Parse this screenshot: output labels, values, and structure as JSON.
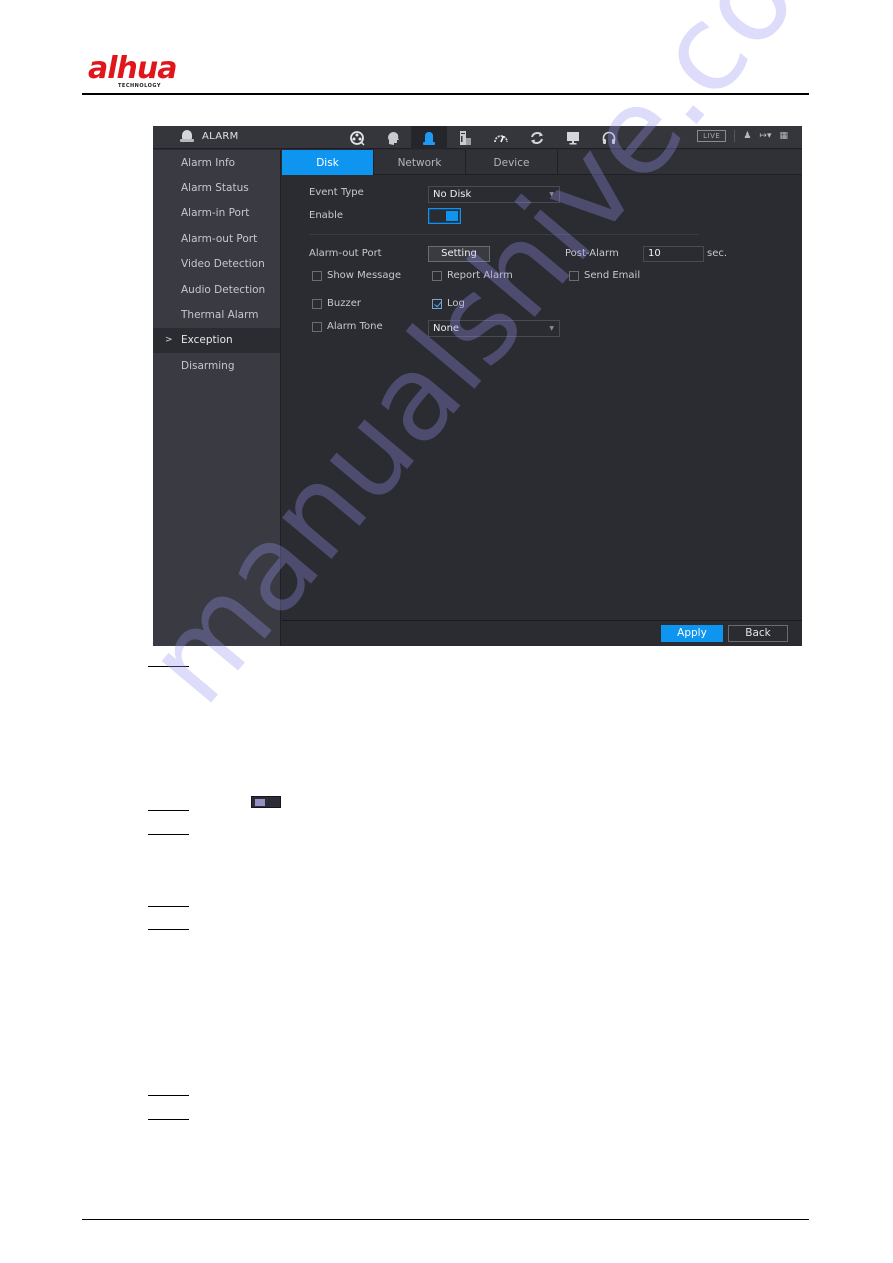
{
  "document": {
    "brand": {
      "name": "alhua",
      "tagline": "TECHNOLOGY",
      "color": "#e0161b"
    },
    "watermark": "manualshive.com"
  },
  "ui": {
    "window": {
      "title": "ALARM",
      "title_icon": "alarm-bell-icon"
    },
    "nav_icons": [
      {
        "name": "playback-icon",
        "active": false
      },
      {
        "name": "ai-face-icon",
        "active": false
      },
      {
        "name": "alarm-bell-icon",
        "active": true
      },
      {
        "name": "storage-icon",
        "active": false
      },
      {
        "name": "performance-gauge-icon",
        "active": false
      },
      {
        "name": "sync-icon",
        "active": false
      },
      {
        "name": "display-monitor-icon",
        "active": false
      },
      {
        "name": "audio-headset-icon",
        "active": false
      }
    ],
    "toolbar": {
      "live_label": "LIVE",
      "user_icon": "user-icon",
      "logout_icon": "logout-icon",
      "grid_icon": "grid-icon"
    },
    "sidebar": {
      "items": [
        {
          "label": "Alarm Info",
          "active": false
        },
        {
          "label": "Alarm Status",
          "active": false
        },
        {
          "label": "Alarm-in Port",
          "active": false
        },
        {
          "label": "Alarm-out Port",
          "active": false
        },
        {
          "label": "Video Detection",
          "active": false
        },
        {
          "label": "Audio Detection",
          "active": false
        },
        {
          "label": "Thermal Alarm",
          "active": false
        },
        {
          "label": "Exception",
          "active": true
        },
        {
          "label": "Disarming",
          "active": false
        }
      ],
      "active_marker": ">"
    },
    "tabs": [
      {
        "label": "Disk",
        "active": true
      },
      {
        "label": "Network",
        "active": false
      },
      {
        "label": "Device",
        "active": false
      }
    ],
    "form": {
      "event_type_label": "Event Type",
      "event_type_value": "No Disk",
      "enable_label": "Enable",
      "enable_on": true,
      "alarm_out_port_label": "Alarm-out Port",
      "setting_button": "Setting",
      "post_alarm_label": "Post-Alarm",
      "post_alarm_value": "10",
      "post_alarm_unit": "sec.",
      "checkboxes": {
        "show_message": {
          "label": "Show Message",
          "checked": false
        },
        "report_alarm": {
          "label": "Report Alarm",
          "checked": false
        },
        "send_email": {
          "label": "Send Email",
          "checked": false
        },
        "buzzer": {
          "label": "Buzzer",
          "checked": false
        },
        "log": {
          "label": "Log",
          "checked": true
        },
        "alarm_tone": {
          "label": "Alarm Tone",
          "checked": false
        }
      },
      "alarm_tone_value": "None"
    },
    "footer": {
      "apply_label": "Apply",
      "back_label": "Back"
    },
    "colors": {
      "accent": "#0d95f0",
      "panel": "#2b2c31",
      "sidebar": "#3a3b42"
    }
  }
}
